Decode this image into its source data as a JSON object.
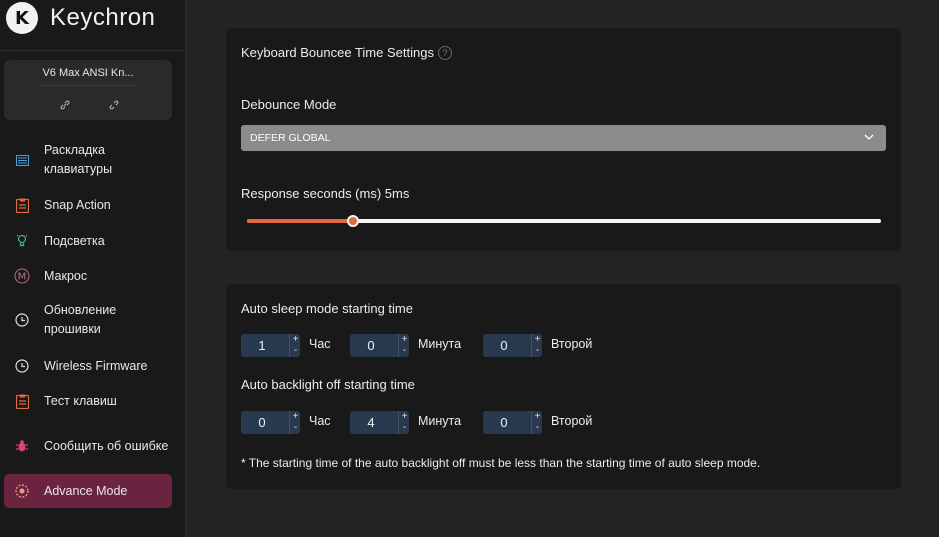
{
  "brand": {
    "logo_text": "K",
    "name": "Keychron"
  },
  "device": {
    "name": "V6 Max ANSI Kn...",
    "icons": [
      "link-icon",
      "unlink-icon"
    ]
  },
  "sidebar": {
    "items": [
      {
        "label": "Раскладка клавиатуры",
        "icon": "keyboard-layout-icon"
      },
      {
        "label": "Snap Action",
        "icon": "clipboard-icon"
      },
      {
        "label": "Подсветка",
        "icon": "bulb-icon"
      },
      {
        "label": "Макрос",
        "icon": "macro-icon"
      },
      {
        "label": "Обновление прошивки",
        "icon": "firmware-update-icon"
      },
      {
        "label": "Wireless Firmware",
        "icon": "wireless-firmware-icon"
      },
      {
        "label": "Тест клавиш",
        "icon": "clipboard-icon"
      },
      {
        "label": "Сообщить об ошибке",
        "icon": "bug-icon"
      },
      {
        "label": "Advance Mode",
        "icon": "advance-mode-icon",
        "active": true
      }
    ]
  },
  "debounce": {
    "title": "Keyboard Bouncee Time Settings",
    "help_label": "?",
    "mode_label": "Debounce Mode",
    "mode_value": "DEFER GLOBAL",
    "response_label": "Response seconds (ms) 5ms",
    "response_fraction": 0.167
  },
  "sleep": {
    "auto_sleep_label": "Auto sleep mode starting time",
    "auto_sleep": {
      "hours": "1",
      "minutes": "0",
      "seconds": "0"
    },
    "auto_backlight_label": "Auto backlight off starting time",
    "auto_backlight": {
      "hours": "0",
      "minutes": "4",
      "seconds": "0"
    },
    "unit_hours": "Час",
    "unit_minutes": "Минута",
    "unit_seconds": "Второй",
    "note": "* The starting time of the auto backlight off must be less than the starting time of auto sleep mode."
  },
  "colors": {
    "accent": "#e46a3e",
    "active_nav": "#6b2440",
    "stepper_bg": "#2a3a4e"
  }
}
